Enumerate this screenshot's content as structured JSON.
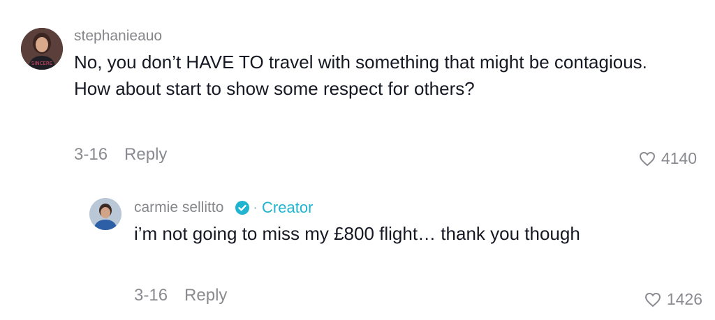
{
  "comments": [
    {
      "username": "stephanieauo",
      "text": "No, you don’t HAVE TO travel with something that might be contagious. How about start to show some respect for others?",
      "date": "3-16",
      "reply_label": "Reply",
      "likes": "4140",
      "avatar_icon": "user-avatar-photo"
    }
  ],
  "reply": {
    "username": "carmie sellitto",
    "badge_separator": "·",
    "badge_label": "Creator",
    "verified_icon": "verified-check-icon",
    "text": "i’m not going to miss my £800 flight… thank you though",
    "date": "3-16",
    "reply_label": "Reply",
    "likes": "1426",
    "avatar_icon": "user-avatar-photo"
  },
  "colors": {
    "accent": "#20b4d1",
    "muted": "#86878b",
    "text": "#161823"
  }
}
